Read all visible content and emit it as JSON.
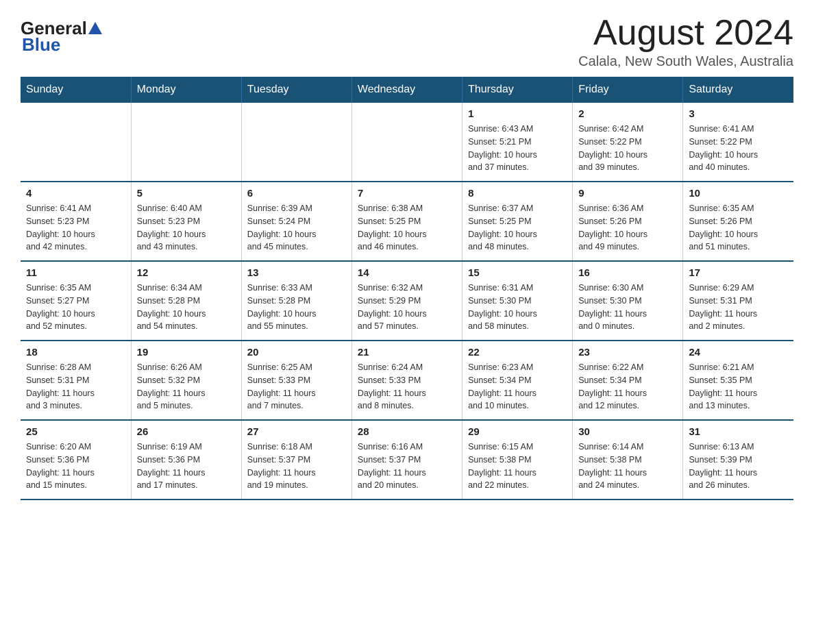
{
  "header": {
    "logo_general": "General",
    "logo_blue": "Blue",
    "month_title": "August 2024",
    "location": "Calala, New South Wales, Australia"
  },
  "weekdays": [
    "Sunday",
    "Monday",
    "Tuesday",
    "Wednesday",
    "Thursday",
    "Friday",
    "Saturday"
  ],
  "weeks": [
    [
      {
        "day": "",
        "info": ""
      },
      {
        "day": "",
        "info": ""
      },
      {
        "day": "",
        "info": ""
      },
      {
        "day": "",
        "info": ""
      },
      {
        "day": "1",
        "info": "Sunrise: 6:43 AM\nSunset: 5:21 PM\nDaylight: 10 hours\nand 37 minutes."
      },
      {
        "day": "2",
        "info": "Sunrise: 6:42 AM\nSunset: 5:22 PM\nDaylight: 10 hours\nand 39 minutes."
      },
      {
        "day": "3",
        "info": "Sunrise: 6:41 AM\nSunset: 5:22 PM\nDaylight: 10 hours\nand 40 minutes."
      }
    ],
    [
      {
        "day": "4",
        "info": "Sunrise: 6:41 AM\nSunset: 5:23 PM\nDaylight: 10 hours\nand 42 minutes."
      },
      {
        "day": "5",
        "info": "Sunrise: 6:40 AM\nSunset: 5:23 PM\nDaylight: 10 hours\nand 43 minutes."
      },
      {
        "day": "6",
        "info": "Sunrise: 6:39 AM\nSunset: 5:24 PM\nDaylight: 10 hours\nand 45 minutes."
      },
      {
        "day": "7",
        "info": "Sunrise: 6:38 AM\nSunset: 5:25 PM\nDaylight: 10 hours\nand 46 minutes."
      },
      {
        "day": "8",
        "info": "Sunrise: 6:37 AM\nSunset: 5:25 PM\nDaylight: 10 hours\nand 48 minutes."
      },
      {
        "day": "9",
        "info": "Sunrise: 6:36 AM\nSunset: 5:26 PM\nDaylight: 10 hours\nand 49 minutes."
      },
      {
        "day": "10",
        "info": "Sunrise: 6:35 AM\nSunset: 5:26 PM\nDaylight: 10 hours\nand 51 minutes."
      }
    ],
    [
      {
        "day": "11",
        "info": "Sunrise: 6:35 AM\nSunset: 5:27 PM\nDaylight: 10 hours\nand 52 minutes."
      },
      {
        "day": "12",
        "info": "Sunrise: 6:34 AM\nSunset: 5:28 PM\nDaylight: 10 hours\nand 54 minutes."
      },
      {
        "day": "13",
        "info": "Sunrise: 6:33 AM\nSunset: 5:28 PM\nDaylight: 10 hours\nand 55 minutes."
      },
      {
        "day": "14",
        "info": "Sunrise: 6:32 AM\nSunset: 5:29 PM\nDaylight: 10 hours\nand 57 minutes."
      },
      {
        "day": "15",
        "info": "Sunrise: 6:31 AM\nSunset: 5:30 PM\nDaylight: 10 hours\nand 58 minutes."
      },
      {
        "day": "16",
        "info": "Sunrise: 6:30 AM\nSunset: 5:30 PM\nDaylight: 11 hours\nand 0 minutes."
      },
      {
        "day": "17",
        "info": "Sunrise: 6:29 AM\nSunset: 5:31 PM\nDaylight: 11 hours\nand 2 minutes."
      }
    ],
    [
      {
        "day": "18",
        "info": "Sunrise: 6:28 AM\nSunset: 5:31 PM\nDaylight: 11 hours\nand 3 minutes."
      },
      {
        "day": "19",
        "info": "Sunrise: 6:26 AM\nSunset: 5:32 PM\nDaylight: 11 hours\nand 5 minutes."
      },
      {
        "day": "20",
        "info": "Sunrise: 6:25 AM\nSunset: 5:33 PM\nDaylight: 11 hours\nand 7 minutes."
      },
      {
        "day": "21",
        "info": "Sunrise: 6:24 AM\nSunset: 5:33 PM\nDaylight: 11 hours\nand 8 minutes."
      },
      {
        "day": "22",
        "info": "Sunrise: 6:23 AM\nSunset: 5:34 PM\nDaylight: 11 hours\nand 10 minutes."
      },
      {
        "day": "23",
        "info": "Sunrise: 6:22 AM\nSunset: 5:34 PM\nDaylight: 11 hours\nand 12 minutes."
      },
      {
        "day": "24",
        "info": "Sunrise: 6:21 AM\nSunset: 5:35 PM\nDaylight: 11 hours\nand 13 minutes."
      }
    ],
    [
      {
        "day": "25",
        "info": "Sunrise: 6:20 AM\nSunset: 5:36 PM\nDaylight: 11 hours\nand 15 minutes."
      },
      {
        "day": "26",
        "info": "Sunrise: 6:19 AM\nSunset: 5:36 PM\nDaylight: 11 hours\nand 17 minutes."
      },
      {
        "day": "27",
        "info": "Sunrise: 6:18 AM\nSunset: 5:37 PM\nDaylight: 11 hours\nand 19 minutes."
      },
      {
        "day": "28",
        "info": "Sunrise: 6:16 AM\nSunset: 5:37 PM\nDaylight: 11 hours\nand 20 minutes."
      },
      {
        "day": "29",
        "info": "Sunrise: 6:15 AM\nSunset: 5:38 PM\nDaylight: 11 hours\nand 22 minutes."
      },
      {
        "day": "30",
        "info": "Sunrise: 6:14 AM\nSunset: 5:38 PM\nDaylight: 11 hours\nand 24 minutes."
      },
      {
        "day": "31",
        "info": "Sunrise: 6:13 AM\nSunset: 5:39 PM\nDaylight: 11 hours\nand 26 minutes."
      }
    ]
  ]
}
